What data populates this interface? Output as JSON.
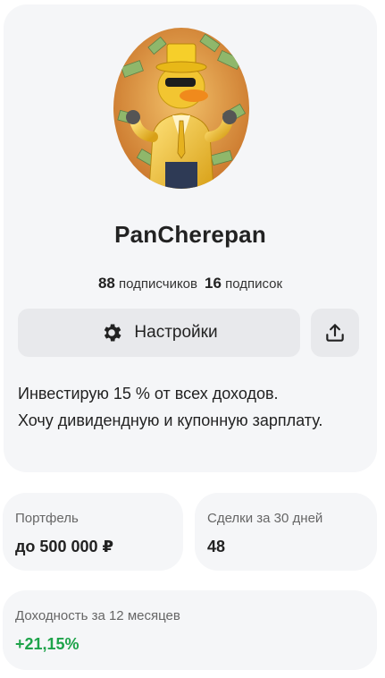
{
  "profile": {
    "username": "PanCherepan",
    "followers_count": "88",
    "followers_label": "подписчиков",
    "following_count": "16",
    "following_label": "подписок",
    "settings_label": "Настройки",
    "bio_line1": "Инвестирую 15 % от всех доходов.",
    "bio_line2": "Хочу дивидендную и купонную зарплату.",
    "avatar_icon": "duck-in-gold-suit-avatar",
    "settings_icon": "gear-icon",
    "share_icon": "share-upload-icon"
  },
  "cards": {
    "portfolio_label": "Портфель",
    "portfolio_value": "до 500 000 ₽",
    "deals_label": "Сделки за 30 дней",
    "deals_value": "48",
    "yield_label": "Доходность за 12 месяцев",
    "yield_value": "+21,15%"
  },
  "colors": {
    "card_bg": "#f5f6f8",
    "button_bg": "#e8e9ec",
    "positive": "#1ea34a"
  }
}
